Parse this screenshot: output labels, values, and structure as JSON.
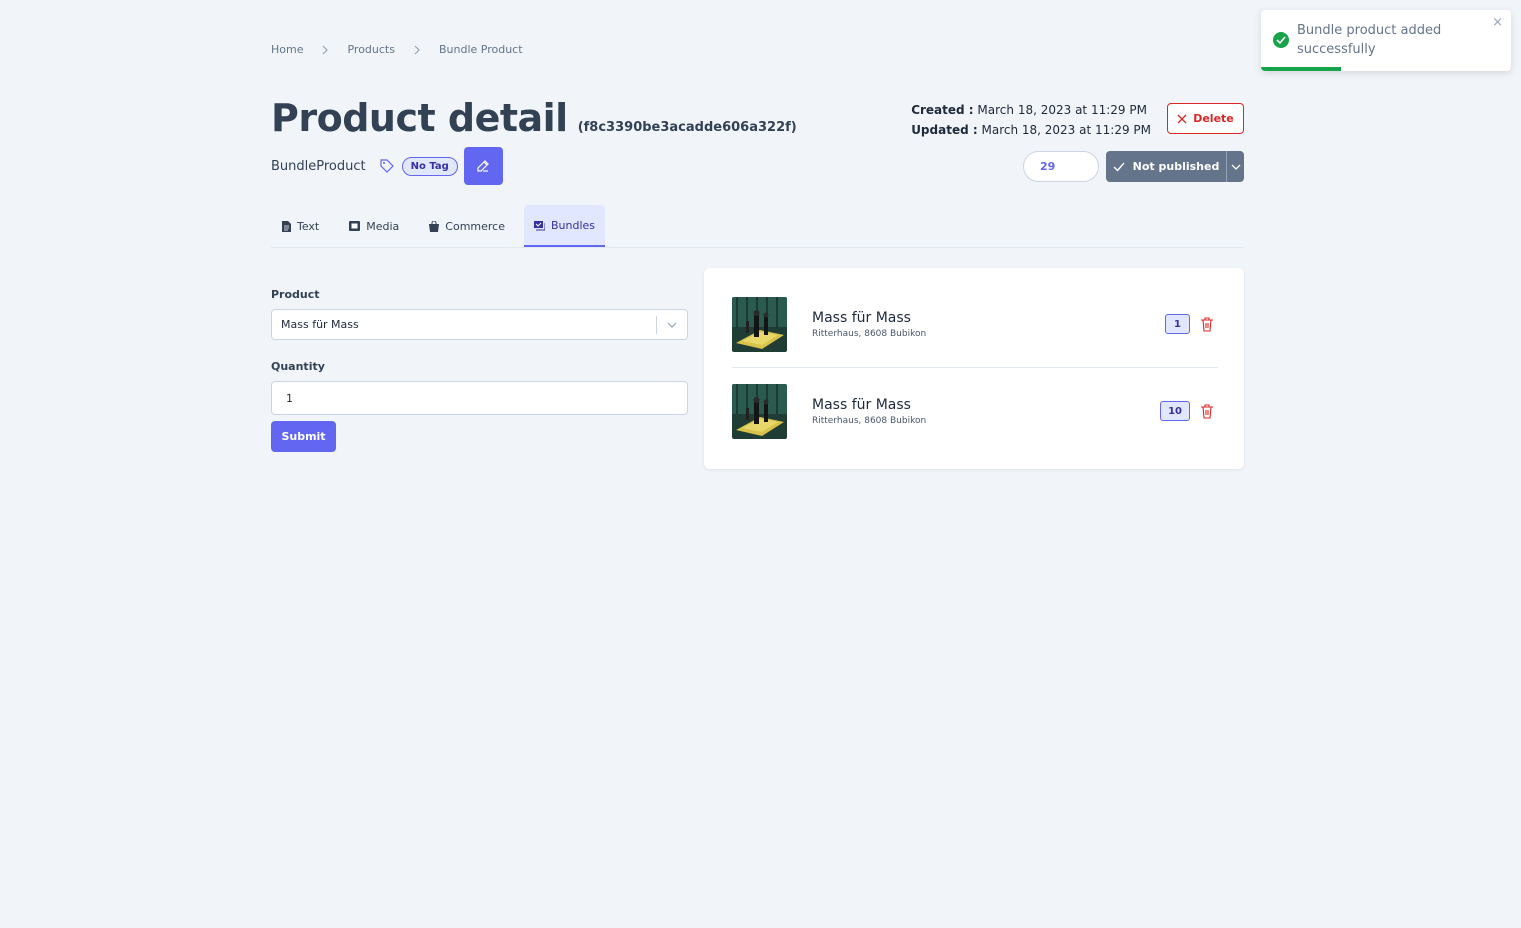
{
  "breadcrumb": [
    "Home",
    "Products",
    "Bundle Product"
  ],
  "header": {
    "title": "Product detail",
    "id": "(f8c3390be3acadde606a322f)",
    "type": "BundleProduct",
    "tag": "No Tag",
    "created_label": "Created :",
    "created_value": "March 18, 2023 at 11:29 PM",
    "updated_label": "Updated :",
    "updated_value": "March 18, 2023 at 11:29 PM",
    "delete_label": "Delete",
    "sequence_value": "29",
    "publish_label": "Not published"
  },
  "tabs": [
    {
      "label": "Text",
      "icon": "document-icon"
    },
    {
      "label": "Media",
      "icon": "film-icon"
    },
    {
      "label": "Commerce",
      "icon": "shopping-bag-icon"
    },
    {
      "label": "Bundles",
      "icon": "bundle-icon",
      "active": true
    }
  ],
  "form": {
    "product_label": "Product",
    "product_value": "Mass für Mass",
    "quantity_label": "Quantity",
    "quantity_value": "1",
    "submit_label": "Submit"
  },
  "bundle_items": [
    {
      "title": "Mass für Mass",
      "subtitle": "Ritterhaus, 8608 Bubikon",
      "quantity": "1"
    },
    {
      "title": "Mass für Mass",
      "subtitle": "Ritterhaus, 8608 Bubikon",
      "quantity": "10"
    }
  ],
  "toast": {
    "message": "Bundle product added successfully",
    "close": "×",
    "progress": 0.32
  },
  "colors": {
    "accent": "#6366f1",
    "danger": "#dc2626",
    "success": "#16a34a",
    "background": "#f1f5f9"
  }
}
